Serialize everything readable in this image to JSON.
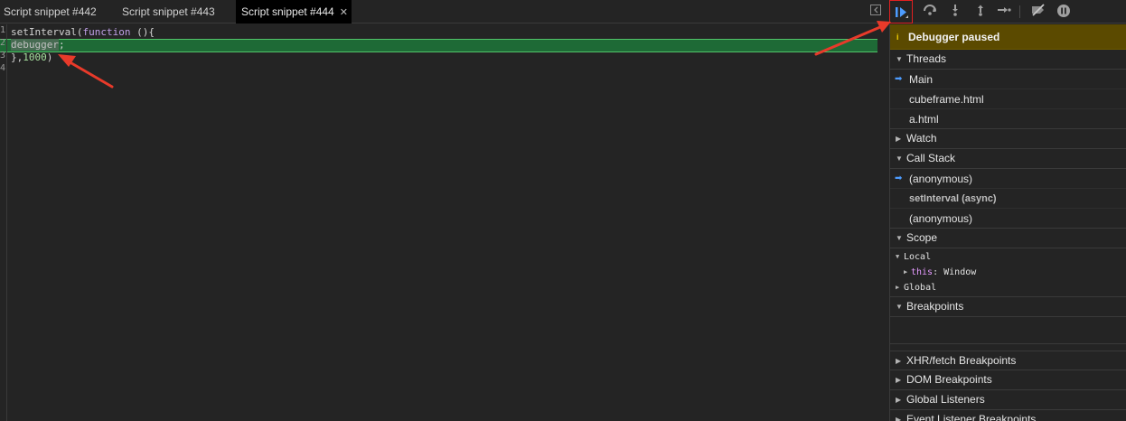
{
  "tabs": [
    {
      "label": "Script snippet #442"
    },
    {
      "label": "Script snippet #443"
    },
    {
      "label": "Script snippet #444",
      "active": true,
      "close": "✕"
    }
  ],
  "editor": {
    "line_numbers": [
      "1",
      "2",
      "3",
      "4"
    ],
    "lines": [
      {
        "parts": [
          [
            "setInterval(",
            ""
          ],
          [
            "function",
            "fn"
          ],
          [
            " (){",
            ""
          ]
        ]
      },
      {
        "parts": [
          [
            "debugger",
            "dbg"
          ],
          [
            ";",
            ""
          ]
        ]
      },
      {
        "parts": [
          [
            "},",
            ""
          ],
          [
            "1000",
            "num"
          ],
          [
            ")",
            ""
          ]
        ]
      },
      {
        "parts": [
          [
            "",
            ""
          ]
        ]
      }
    ],
    "paused_line": 2
  },
  "toolbar": {
    "icons": [
      "toggle-navigator-icon",
      "resume-icon",
      "step-over-icon",
      "step-into-icon",
      "step-out-icon",
      "step-icon",
      "deactivate-breakpoints-icon",
      "pause-on-exceptions-icon"
    ]
  },
  "sidebar": {
    "banner": "Debugger paused",
    "threads": {
      "title": "Threads",
      "items": [
        "Main",
        "cubeframe.html",
        "a.html"
      ]
    },
    "watch": {
      "title": "Watch"
    },
    "call_stack": {
      "title": "Call Stack",
      "items": [
        "(anonymous)",
        "setInterval (async)",
        "(anonymous)"
      ]
    },
    "scope": {
      "title": "Scope",
      "local": "Local",
      "this_key": "this",
      "this_value": "Window",
      "global": "Global"
    },
    "breakpoints": {
      "title": "Breakpoints"
    },
    "xhr": {
      "title": "XHR/fetch Breakpoints"
    },
    "dom": {
      "title": "DOM Breakpoints"
    },
    "global_listeners": {
      "title": "Global Listeners"
    },
    "event_listeners": {
      "title": "Event Listener Breakpoints"
    }
  },
  "colors": {
    "paused_line": "#1e6a36",
    "banner_bg": "#5b4a00",
    "annotation_arrow": "#e83a2a",
    "resume_blue": "#4d9cff"
  }
}
